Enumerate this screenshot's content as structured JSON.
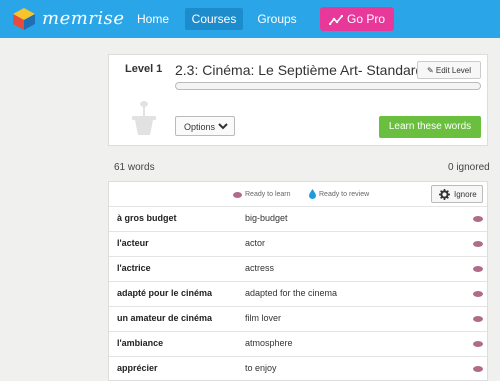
{
  "header": {
    "logo_text": "memrise",
    "nav": [
      "Home",
      "Courses",
      "Groups"
    ],
    "active_nav": "Courses",
    "go_pro": "Go Pro"
  },
  "level": {
    "label": "Level 1",
    "title": "2.3: Cinéma: Le Septième Art- Standard",
    "edit_label": "Edit Level",
    "progress_fraction": 0,
    "options_label": "Options",
    "learn_label": "Learn these words"
  },
  "stats": {
    "word_count": "61 words",
    "ignored": "0 ignored"
  },
  "legend": {
    "ready_to_learn": "Ready to learn",
    "ready_to_review": "Ready to review",
    "ignore_label": "Ignore"
  },
  "words": [
    {
      "term": "à gros budget",
      "definition": "big-budget"
    },
    {
      "term": "l'acteur",
      "definition": "actor"
    },
    {
      "term": "l'actrice",
      "definition": "actress"
    },
    {
      "term": "adapté pour le cinéma",
      "definition": "adapted for the cinema"
    },
    {
      "term": "un amateur de cinéma",
      "definition": "film lover"
    },
    {
      "term": "l'ambiance",
      "definition": "atmosphere"
    },
    {
      "term": "apprécier",
      "definition": "to enjoy"
    }
  ],
  "colors": {
    "header_bg": "#2aa6e8",
    "go_pro_bg": "#e8399a",
    "learn_bg": "#6bbf3f",
    "learn_status": "#b06b88",
    "review_status": "#1e9be0"
  }
}
